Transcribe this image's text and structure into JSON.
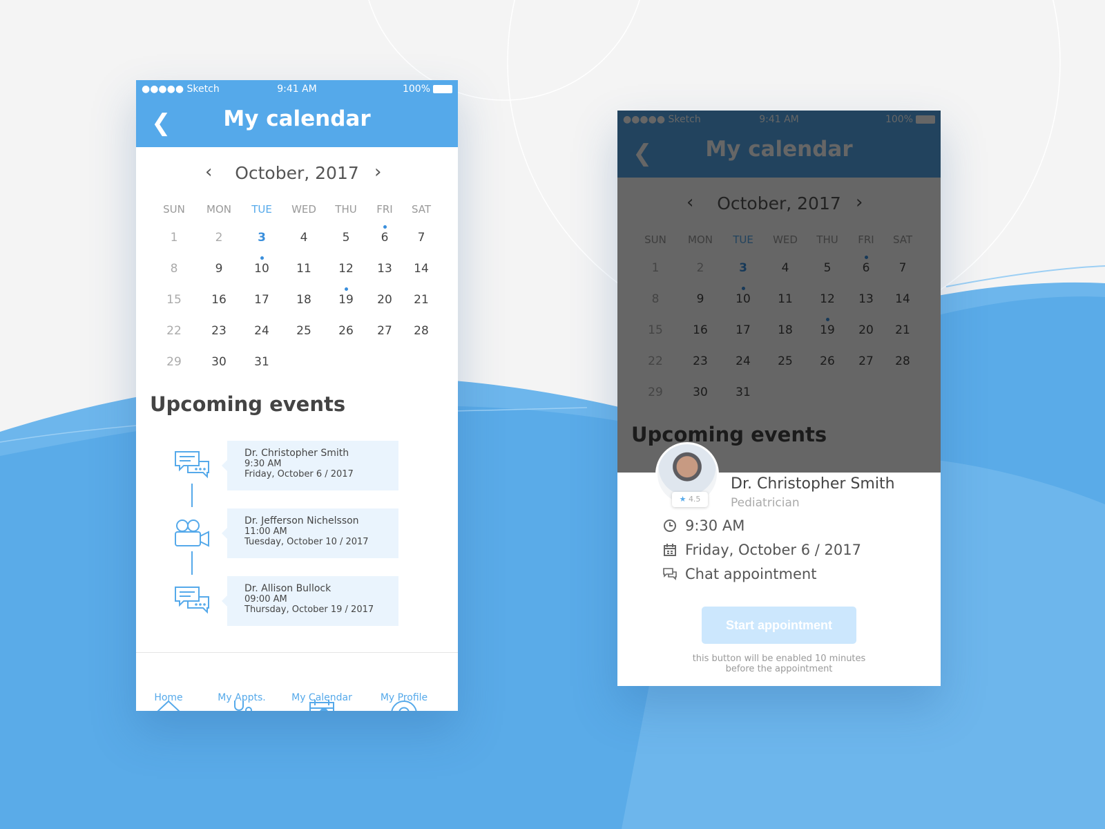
{
  "status_bar": {
    "carrier": "●●●●● Sketch",
    "time": "9:41 AM",
    "battery": "100%"
  },
  "header": {
    "title": "My calendar",
    "back_icon": "chevron-left-icon"
  },
  "calendar": {
    "month_label": "October, 2017",
    "weekdays": [
      "SUN",
      "MON",
      "TUE",
      "WED",
      "THU",
      "FRI",
      "SAT"
    ],
    "today": 3,
    "days_in_month": 31,
    "first_weekday": 0,
    "muted_days": [
      1,
      2,
      8,
      15,
      22,
      29
    ],
    "event_days": [
      6,
      10,
      19
    ]
  },
  "upcoming": {
    "title": "Upcoming events",
    "events": [
      {
        "doctor": "Dr. Christopher Smith",
        "time": "9:30 AM",
        "date": "Friday, October 6 / 2017",
        "type_icon": "chat-icon"
      },
      {
        "doctor": "Dr. Jefferson Nichelsson",
        "time": "11:00 AM",
        "date": "Tuesday, October 10 / 2017",
        "type_icon": "video-camera-icon"
      },
      {
        "doctor": "Dr. Allison Bullock",
        "time": "09:00 AM",
        "date": "Thursday, October 19 / 2017",
        "type_icon": "chat-icon"
      }
    ]
  },
  "tabbar": {
    "items": [
      {
        "label": "Home",
        "icon": "home-icon"
      },
      {
        "label": "My Appts.",
        "icon": "stethoscope-icon"
      },
      {
        "label": "My Calendar",
        "icon": "calendar-icon",
        "active": true
      },
      {
        "label": "My Profile",
        "icon": "profile-icon"
      }
    ]
  },
  "detail": {
    "doctor": "Dr. Christopher Smith",
    "specialty": "Pediatrician",
    "rating": "4.5",
    "time": "9:30 AM",
    "date": "Friday, October 6 / 2017",
    "type": "Chat appointment",
    "button": "Start appointment",
    "note_line1": "this button will be enabled 10 minutes",
    "note_line2": "before the appointment"
  },
  "colors": {
    "accent": "#55a9ea",
    "background_wave": "#5aabe8",
    "card": "#eaf4fd",
    "button_disabled": "#cce7fd"
  }
}
